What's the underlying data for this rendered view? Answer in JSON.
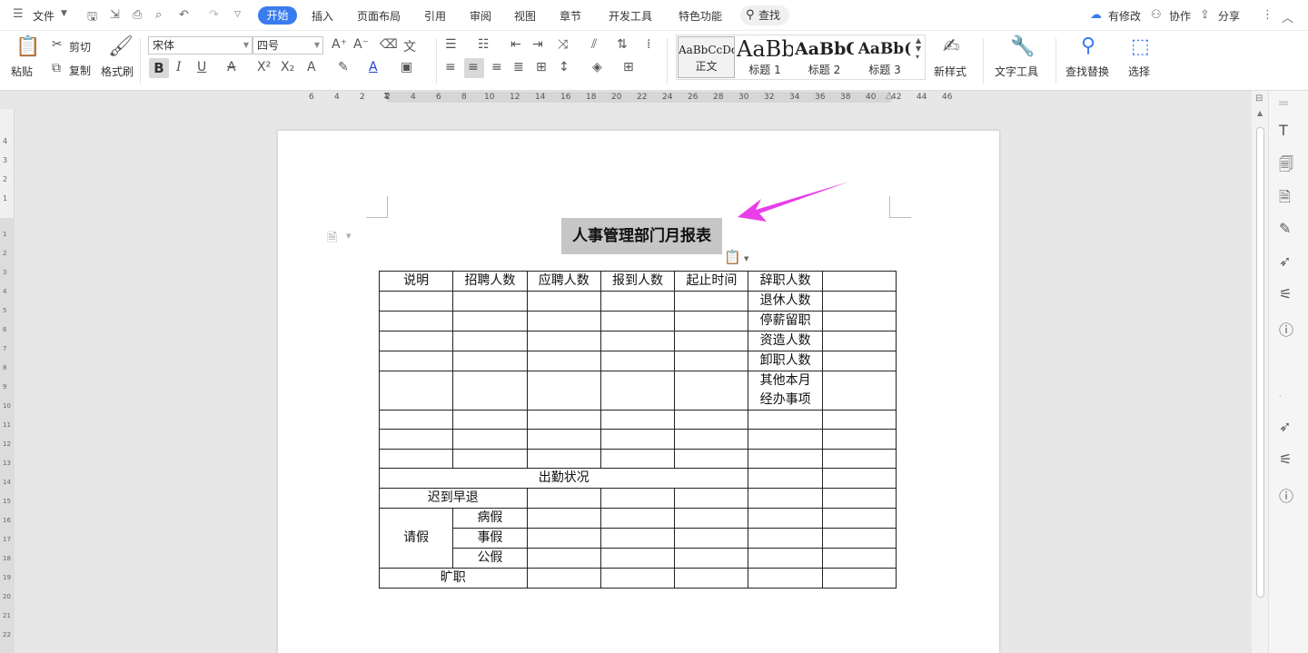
{
  "menubar": {
    "file_label": "文件",
    "tabs": [
      "开始",
      "插入",
      "页面布局",
      "引用",
      "审阅",
      "视图",
      "章节",
      "开发工具",
      "特色功能"
    ],
    "search_label": "查找",
    "right": {
      "changes": "有修改",
      "collab": "协作",
      "share": "分享"
    }
  },
  "ribbon": {
    "paste": "粘贴",
    "cut": "剪切",
    "copy": "复制",
    "format_painter": "格式刷",
    "font_name": "宋体",
    "font_size": "四号",
    "styles": [
      {
        "sample": "AaBbCcDd",
        "name": "正文"
      },
      {
        "sample": "AaBb",
        "name": "标题 1"
      },
      {
        "sample": "AaBbC",
        "name": "标题 2"
      },
      {
        "sample": "AaBb(",
        "name": "标题 3"
      }
    ],
    "new_style": "新样式",
    "text_tools": "文字工具",
    "find_replace": "查找替换",
    "select": "选择"
  },
  "ruler": {
    "h_marks": [
      "6",
      "4",
      "2",
      "2",
      "4",
      "6",
      "8",
      "10",
      "12",
      "14",
      "16",
      "18",
      "20",
      "22",
      "24",
      "26",
      "28",
      "30",
      "32",
      "34",
      "36",
      "38",
      "40",
      "42",
      "44",
      "46"
    ],
    "v_marks_top": [
      "4",
      "3",
      "2",
      "1"
    ],
    "v_marks": [
      "1",
      "2",
      "3",
      "4",
      "5",
      "6",
      "7",
      "8",
      "9",
      "10",
      "11",
      "12",
      "13",
      "14",
      "15",
      "16",
      "17",
      "18",
      "19",
      "20",
      "21",
      "22"
    ]
  },
  "document": {
    "title": "人事管理部门月报表",
    "table": {
      "header": [
        "说明",
        "招聘人数",
        "应聘人数",
        "报到人数",
        "起止时间",
        "辞职人数",
        ""
      ],
      "col6_rows": [
        "退休人数",
        "停薪留职",
        "资造人数",
        "卸职人数",
        "其他本月经办事项"
      ],
      "attendance": "出勤状况",
      "late": "迟到早退",
      "leave": "请假",
      "leave_types": [
        "病假",
        "事假",
        "公假"
      ],
      "absent": "旷职"
    }
  },
  "colors": {
    "accent": "#3a7cf0",
    "arrow": "#e83ee8",
    "selection": "#c6c6c6"
  }
}
